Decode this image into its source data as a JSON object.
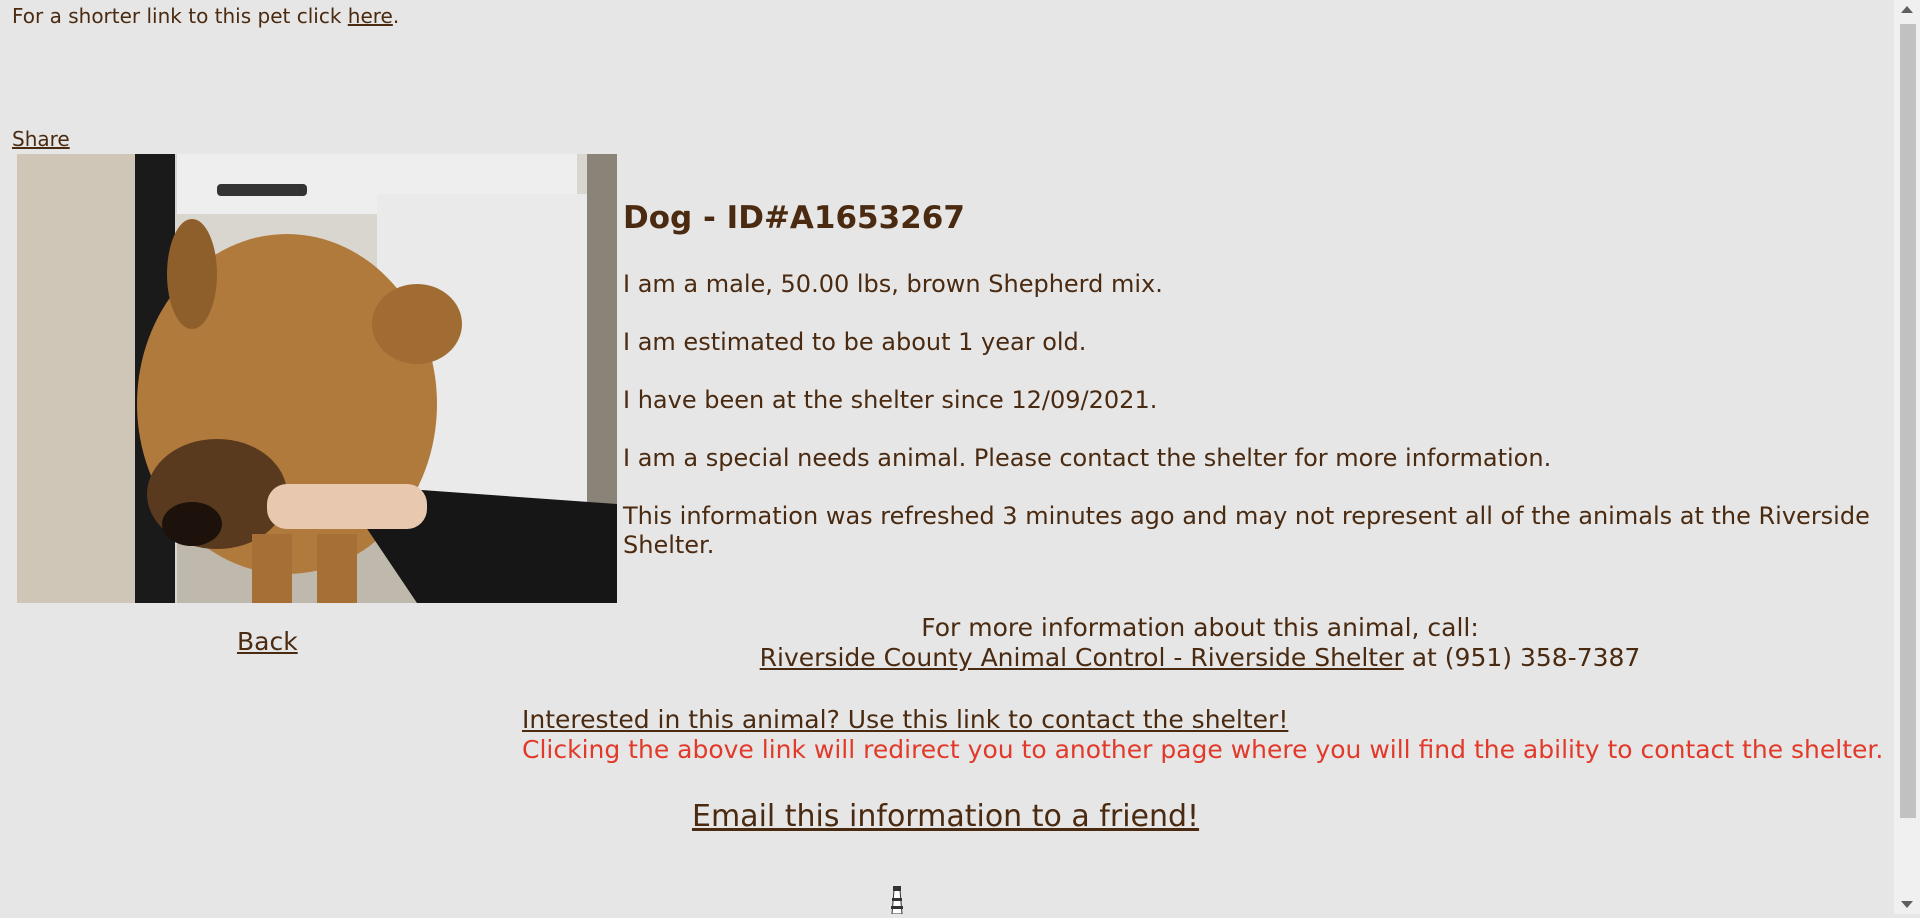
{
  "top": {
    "prefix": "For a shorter link to this pet click ",
    "link": "here",
    "suffix": "."
  },
  "share_label": "Share",
  "photo": {
    "subject": "brown shepherd mix dog in kennel"
  },
  "animal": {
    "title": "Dog - ID#A1653267",
    "lines": [
      "I am a male, 50.00 lbs, brown Shepherd mix.",
      "I am estimated to be about 1 year old.",
      "I have been at the shelter since 12/09/2021.",
      "I am a special needs animal. Please contact the shelter for more information.",
      "This information was refreshed 3 minutes ago and may not represent all of the animals at the Riverside Shelter."
    ]
  },
  "back_label": "Back",
  "contact": {
    "intro": "For more information about this animal, call:",
    "shelter_link": "Riverside County Animal Control - Riverside Shelter",
    "phone": " at (951) 358-7387"
  },
  "interest": {
    "link": "Interested in this animal? Use this link to contact the shelter!",
    "note": "Clicking the above link will redirect you to another page where you will find the ability to contact the shelter."
  },
  "email_label": "Email this information to a friend!",
  "colors": {
    "background": "#e6e6e6",
    "text": "#4a2a10",
    "warning": "#e23a2a"
  }
}
